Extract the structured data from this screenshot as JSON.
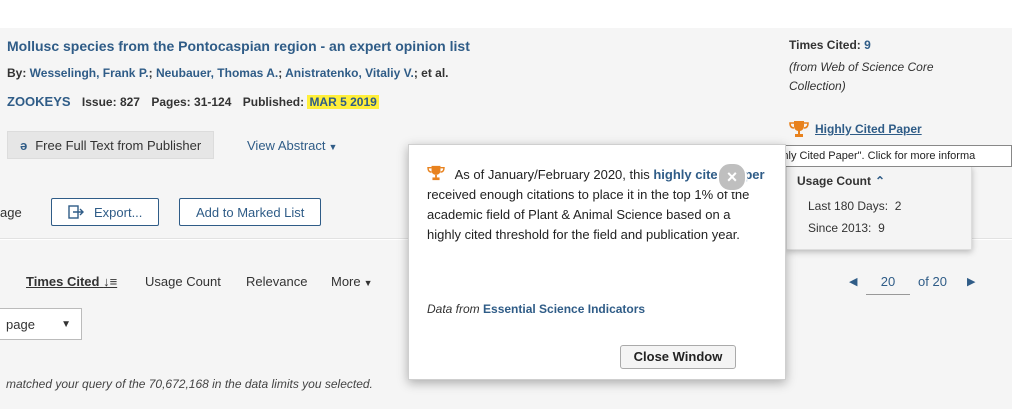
{
  "record": {
    "title": "Mollusc species from the Pontocaspian region - an expert opinion list",
    "by_label": "By: ",
    "authors": [
      "Wesselingh, Frank P.",
      "Neubauer, Thomas A.",
      "Anistratenko, Vitaliy V."
    ],
    "authors_sep": "; ",
    "et_al": "; et al.",
    "journal": "ZOOKEYS",
    "issue_label": "Issue:",
    "issue": "827",
    "pages_label": "Pages:",
    "pages": "31-124",
    "published_label": "Published:",
    "published": "MAR 5 2019",
    "free_full_text": "Free Full Text from Publisher",
    "view_abstract": "View Abstract"
  },
  "times_cited": {
    "label": "Times Cited:",
    "count": "9",
    "source": "(from Web of Science Core Collection)",
    "highly_cited": "Highly Cited Paper",
    "tooltip": "This is a \"Highly Cited Paper\". Click for more informa"
  },
  "usage": {
    "title": "Usage Count",
    "last_180_label": "Last 180 Days:",
    "last_180": "2",
    "since_label": "Since 2013:",
    "since": "9"
  },
  "toolbar": {
    "page_fragment": "age",
    "export": "Export...",
    "add_marked": "Add to Marked List"
  },
  "sort": {
    "times_cited": "Times Cited",
    "usage_count": "Usage Count",
    "relevance": "Relevance",
    "more": "More"
  },
  "pager": {
    "current": "20",
    "of_label": "of",
    "total": "20"
  },
  "per_page": "page",
  "matched_text": "matched your query of the 70,672,168 in the data limits you selected.",
  "popup": {
    "text_before": "As of January/February 2020, this ",
    "link": "highly cited paper",
    "text_after": " received enough citations to place it in the top 1% of the academic field of Plant & Animal Science based on a highly cited threshold for the field and publication year.",
    "data_from": "Data from ",
    "esi": "Essential Science Indicators",
    "close_window": "Close Window"
  },
  "colors": {
    "link": "#2f5c87",
    "highlight": "#ffef3a",
    "trophy": "#e8821e"
  }
}
